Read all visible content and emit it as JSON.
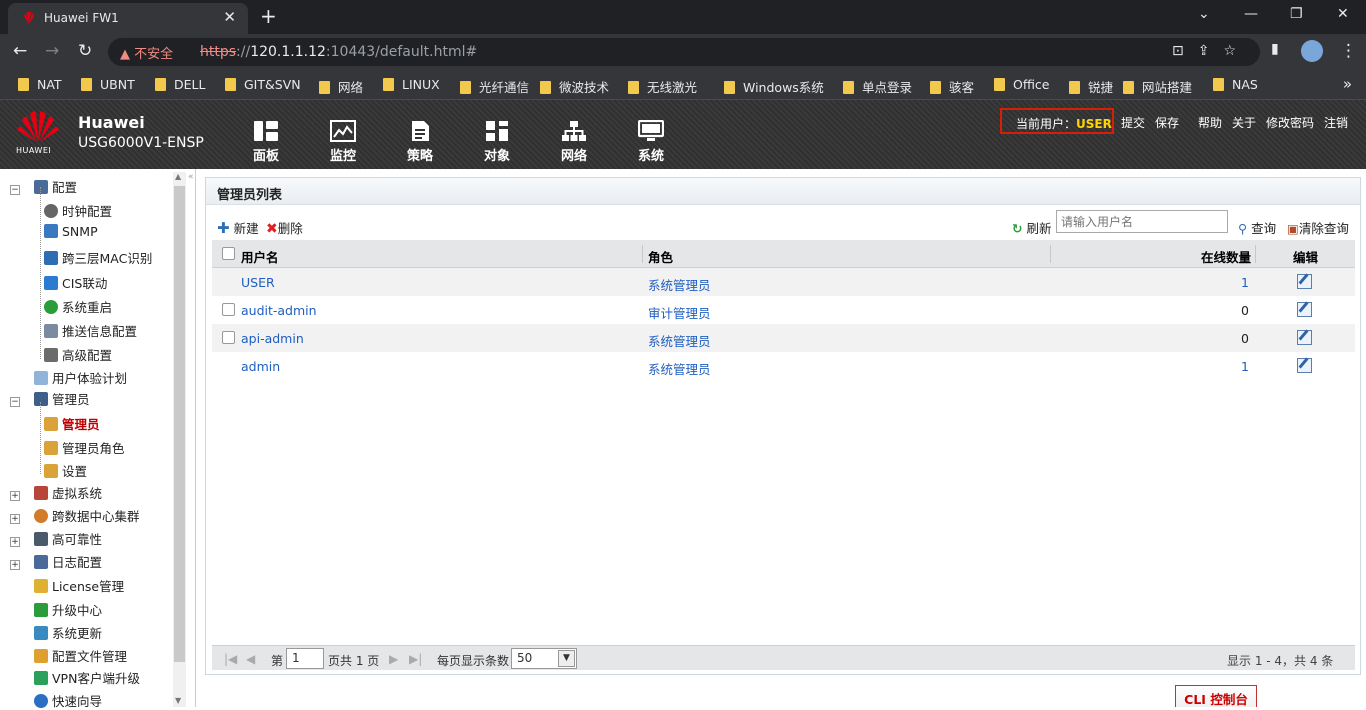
{
  "browser": {
    "tab_title": "Huawei FW1",
    "security_label": "不安全",
    "url_scheme": "https",
    "url_sep": "://",
    "url_host": "120.1.1.12",
    "url_rest": ":10443/default.html#",
    "bookmarks": [
      "NAT",
      "UBNT",
      "DELL",
      "GIT&SVN",
      "网络",
      "LINUX",
      "光纤通信",
      "微波技术",
      "无线激光",
      "Windows系统",
      "单点登录",
      "骇客",
      "Office",
      "锐捷",
      "网站搭建",
      "NAS"
    ]
  },
  "app": {
    "brand_line1": "Huawei",
    "brand_line2": "USG6000V1-ENSP",
    "logo_text": "HUAWEI",
    "modules": [
      "面板",
      "监控",
      "策略",
      "对象",
      "网络",
      "系统"
    ],
    "current_user_label": "当前用户：",
    "current_user": "USER",
    "top_links": [
      "提交",
      "保存",
      "帮助",
      "关于",
      "修改密码",
      "注销"
    ]
  },
  "sidebar": {
    "items": [
      {
        "label": "配置"
      },
      {
        "label": "时钟配置"
      },
      {
        "label": "SNMP"
      },
      {
        "label": "跨三层MAC识别"
      },
      {
        "label": "CIS联动"
      },
      {
        "label": "系统重启"
      },
      {
        "label": "推送信息配置"
      },
      {
        "label": "高级配置"
      },
      {
        "label": "用户体验计划"
      },
      {
        "label": "管理员"
      },
      {
        "label": "管理员"
      },
      {
        "label": "管理员角色"
      },
      {
        "label": "设置"
      },
      {
        "label": "虚拟系统"
      },
      {
        "label": "跨数据中心集群"
      },
      {
        "label": "高可靠性"
      },
      {
        "label": "日志配置"
      },
      {
        "label": "License管理"
      },
      {
        "label": "升级中心"
      },
      {
        "label": "系统更新"
      },
      {
        "label": "配置文件管理"
      },
      {
        "label": "VPN客户端升级"
      },
      {
        "label": "快速向导"
      }
    ]
  },
  "main": {
    "title": "管理员列表",
    "new_label": "新建",
    "delete_label": "删除",
    "refresh_label": "刷新",
    "search_placeholder": "请输入用户名",
    "query_label": "查询",
    "clear_label": "清除查询",
    "columns": {
      "username": "用户名",
      "role": "角色",
      "online": "在线数量",
      "edit": "编辑"
    },
    "rows": [
      {
        "username": "USER",
        "role": "系统管理员",
        "online": "1"
      },
      {
        "username": "audit-admin",
        "role": "审计管理员",
        "online": "0"
      },
      {
        "username": "api-admin",
        "role": "系统管理员",
        "online": "0"
      },
      {
        "username": "admin",
        "role": "系统管理员",
        "online": "1"
      }
    ],
    "pager": {
      "page_prefix": "第",
      "page_value": "1",
      "page_suffix": "页共 1 页",
      "per_page_label": "每页显示条数",
      "per_page_value": "50",
      "summary": "显示 1 - 4，共 4 条"
    }
  },
  "cli_label": "CLI 控制台"
}
